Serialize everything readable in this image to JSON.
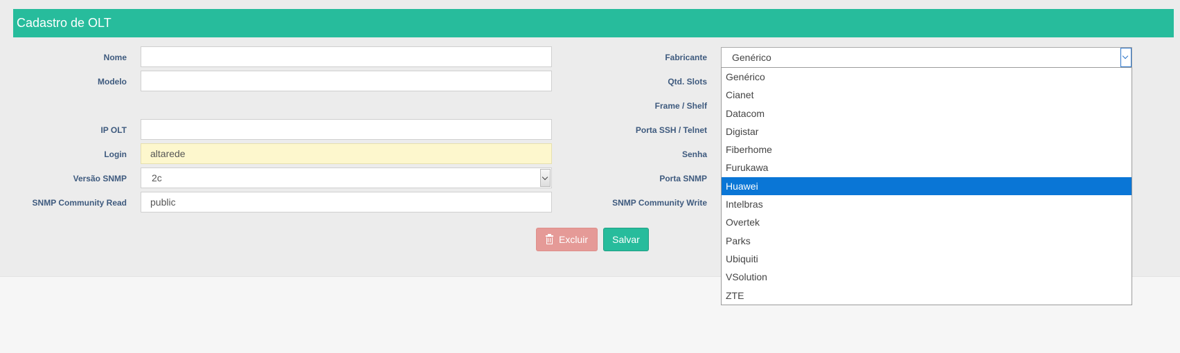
{
  "header": {
    "title": "Cadastro de OLT"
  },
  "form": {
    "nome_label": "Nome",
    "nome_value": "",
    "modelo_label": "Modelo",
    "modelo_value": "",
    "ip_label": "IP OLT",
    "ip_value": "",
    "login_label": "Login",
    "login_value": "altarede",
    "versao_label": "Versão SNMP",
    "versao_value": "2c",
    "community_read_label": "SNMP Community Read",
    "community_read_value": "public",
    "fabricante_label": "Fabricante",
    "fabricante_value": "Genérico",
    "slots_label": "Qtd. Slots",
    "frame_label": "Frame / Shelf",
    "porta_ssh_label": "Porta SSH / Telnet",
    "senha_label": "Senha",
    "porta_snmp_label": "Porta SNMP",
    "community_write_label": "SNMP Community Write"
  },
  "fabricante_options": [
    "Genérico",
    "Cianet",
    "Datacom",
    "Digistar",
    "Fiberhome",
    "Furukawa",
    "Huawei",
    "Intelbras",
    "Overtek",
    "Parks",
    "Ubiquiti",
    "VSolution",
    "ZTE"
  ],
  "fabricante_highlighted": "Huawei",
  "buttons": {
    "delete": "Excluir",
    "save": "Salvar"
  },
  "colors": {
    "accent": "#27bc9c",
    "danger": "#e59a97",
    "highlight": "#0a76d6"
  }
}
